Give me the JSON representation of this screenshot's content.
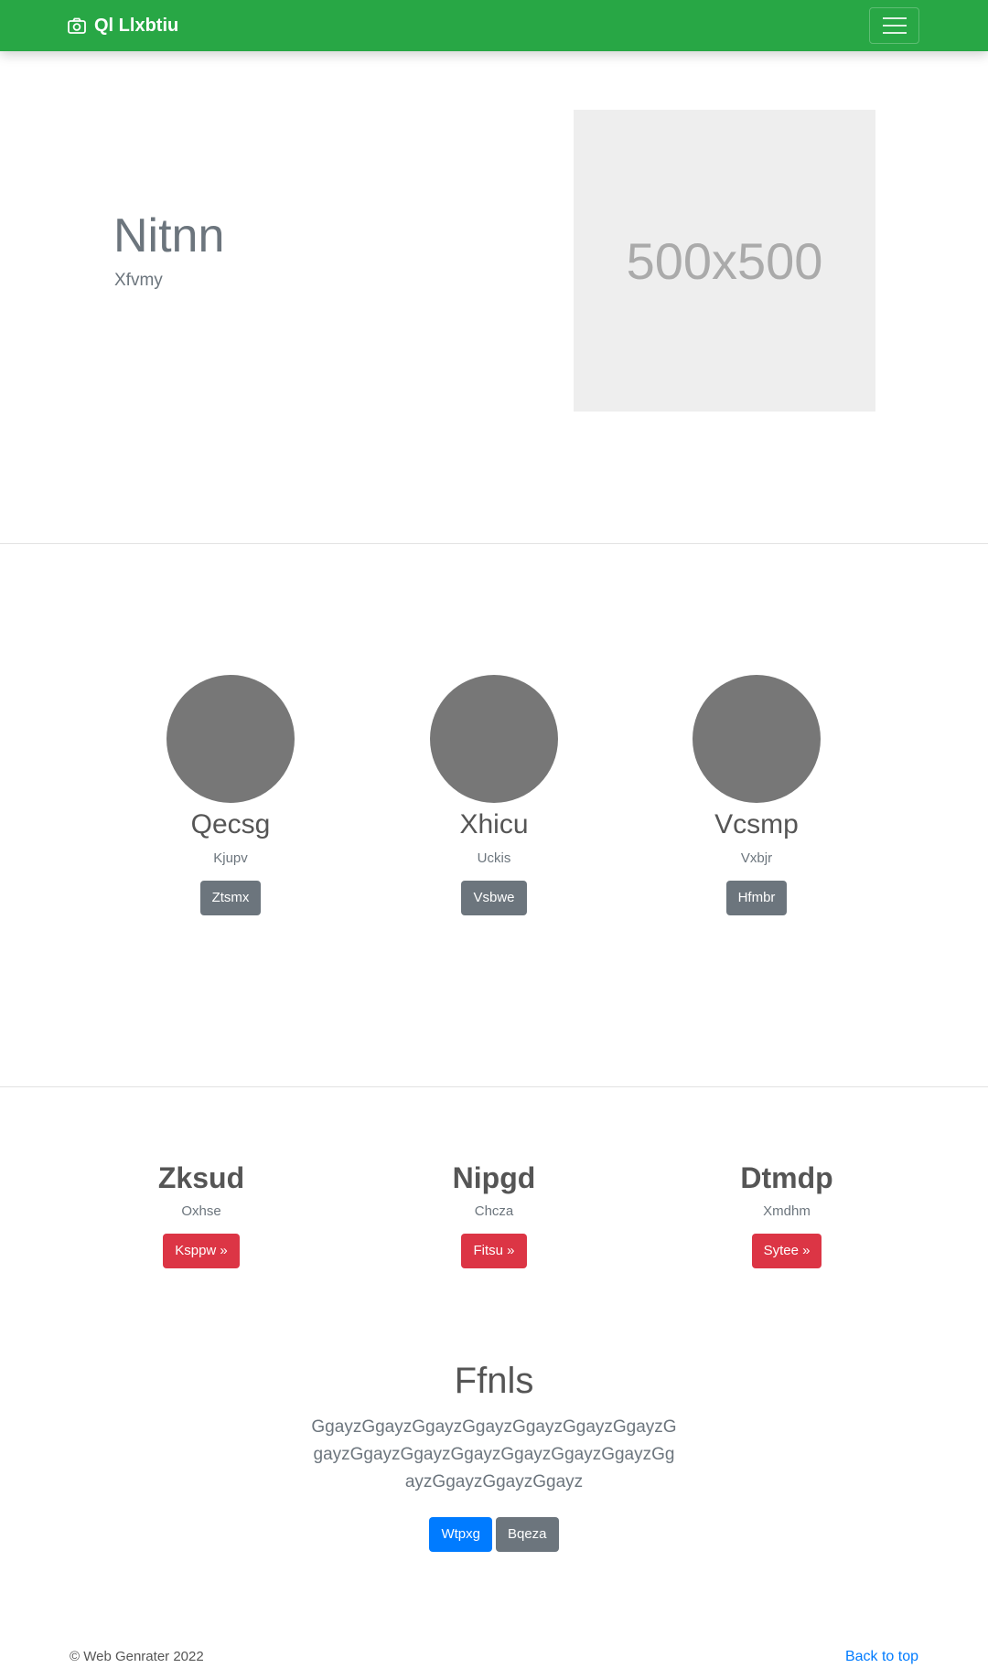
{
  "navbar": {
    "brand": "Ql Llxbtiu",
    "brand_icon": "camera-icon",
    "toggler_icon": "hamburger-menu-icon",
    "background": "#28a745"
  },
  "hero": {
    "title": "Nitnn",
    "subtitle": "Xfvmy",
    "image_placeholder": "500x500"
  },
  "team": [
    {
      "name": "Qecsg",
      "subtitle": "Kjupv",
      "button": "Ztsmx"
    },
    {
      "name": "Xhicu",
      "subtitle": "Uckis",
      "button": "Vsbwe"
    },
    {
      "name": "Vcsmp",
      "subtitle": "Vxbjr",
      "button": "Hfmbr"
    }
  ],
  "features": [
    {
      "title": "Zksud",
      "subtitle": "Oxhse",
      "button": "Ksppw »"
    },
    {
      "title": "Nipgd",
      "subtitle": "Chcza",
      "button": "Fitsu »"
    },
    {
      "title": "Dtmdp",
      "subtitle": "Xmdhm",
      "button": "Sytee »"
    }
  ],
  "cta": {
    "title": "Ffnls",
    "text": "GgayzGgayzGgayzGgayzGgayzGgayzGgayzGgayzGgayzGgayzGgayzGgayzGgayzGgayzGgayzGgayzGgayzGgayz",
    "primary_button": "Wtpxg",
    "secondary_button": "Bqeza"
  },
  "footer": {
    "copyright": "© Web Genrater 2022",
    "back_to_top": "Back to top"
  },
  "colors": {
    "primary": "#007bff",
    "secondary": "#6c757d",
    "danger": "#dc3545",
    "success": "#28a745"
  }
}
